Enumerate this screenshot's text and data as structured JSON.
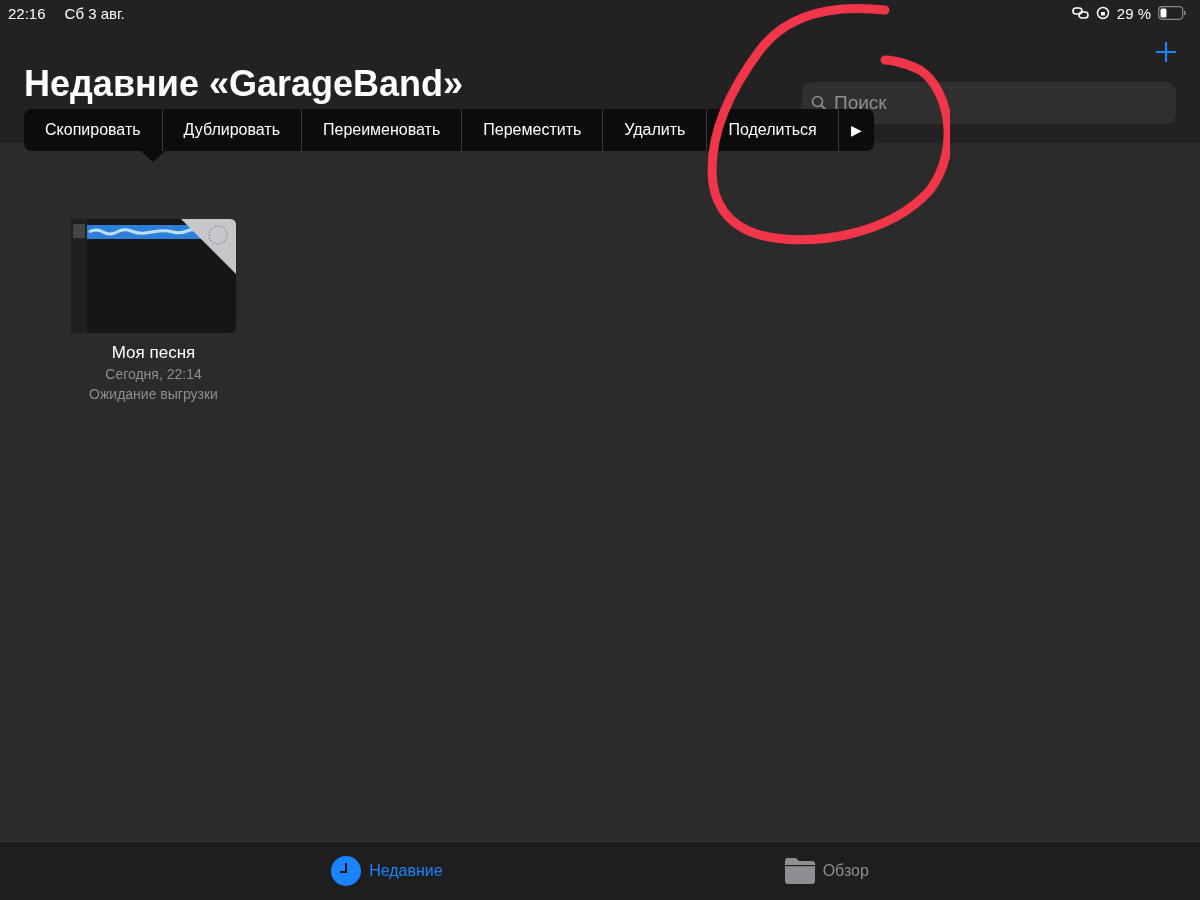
{
  "status_bar": {
    "time": "22:16",
    "date": "Сб 3 авг.",
    "battery": "29 %"
  },
  "header": {
    "title": "Недавние «GarageBand»",
    "search": {
      "placeholder": "Поиск"
    }
  },
  "context_menu": {
    "items": [
      "Скопировать",
      "Дублировать",
      "Переименовать",
      "Переместить",
      "Удалить",
      "Поделиться"
    ],
    "more": "▶"
  },
  "files": [
    {
      "name": "Моя песня",
      "date": "Сегодня, 22:14",
      "status": "Ожидание выгрузки"
    }
  ],
  "tab_bar": [
    {
      "label": "Недавние",
      "kind": "clock",
      "selected": true
    },
    {
      "label": "Обзор",
      "kind": "folder",
      "selected": false
    }
  ]
}
